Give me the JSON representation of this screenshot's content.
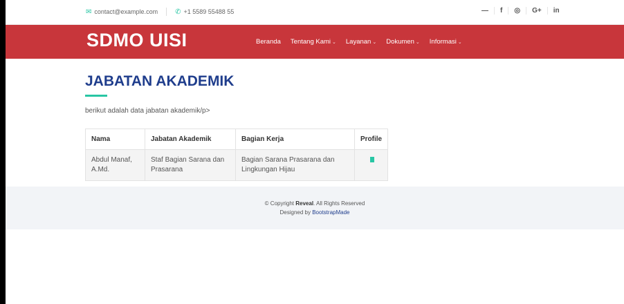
{
  "topbar": {
    "email": "contact@example.com",
    "phone": "+1 5589 55488 55",
    "social_icons": [
      "twitter-icon",
      "facebook-icon",
      "instagram-icon",
      "google-plus-icon",
      "linkedin-icon"
    ],
    "social_glyphs": [
      "—",
      "f",
      "◎",
      "G+",
      "in"
    ]
  },
  "header": {
    "brand": "SDMO UISI",
    "nav": [
      {
        "label": "Beranda",
        "dropdown": false
      },
      {
        "label": "Tentang Kami",
        "dropdown": true
      },
      {
        "label": "Layanan",
        "dropdown": true
      },
      {
        "label": "Dokumen",
        "dropdown": true
      },
      {
        "label": "Informasi",
        "dropdown": true
      }
    ]
  },
  "main": {
    "title": "JABATAN AKADEMIK",
    "intro": "berikut adalah data jabatan akademik/p>",
    "table": {
      "headers": [
        "Nama",
        "Jabatan Akademik",
        "Bagian Kerja",
        "Profile"
      ],
      "rows": [
        {
          "nama": "Abdul Manaf, A.Md.",
          "jabatan": "Staf Bagian Sarana dan Prasarana",
          "bagian": "Bagian Sarana Prasarana dan Lingkungan Hijau",
          "profile_icon": "document-icon"
        }
      ]
    }
  },
  "footer": {
    "copyright_prefix": "© Copyright ",
    "copyright_brand": "Reveal",
    "copyright_suffix": ". All Rights Reserved",
    "designed_prefix": "Designed by ",
    "designed_link": "BootstrapMade"
  },
  "colors": {
    "header_bg": "#c8363b",
    "title": "#1f3d8c",
    "accent": "#28c6a4",
    "footer_bg": "#f2f4f7"
  }
}
